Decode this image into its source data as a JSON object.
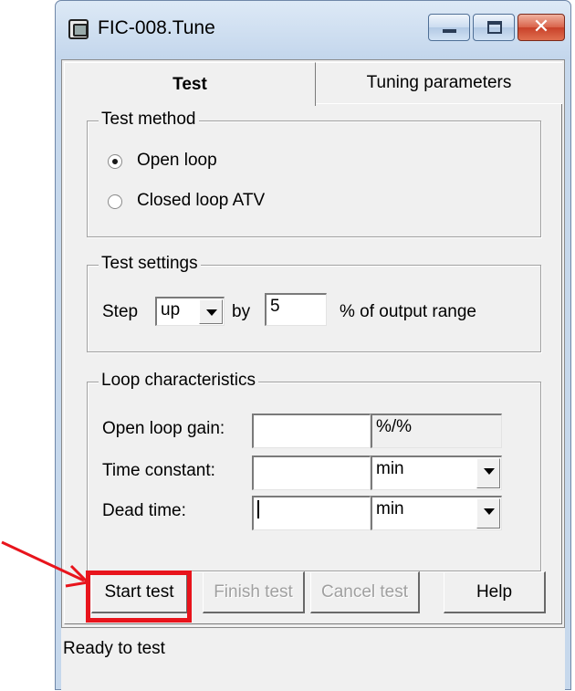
{
  "window": {
    "title": "FIC-008.Tune",
    "icon": "app-window-icon",
    "caption_buttons": [
      "minimize-icon",
      "maximize-icon",
      "close-icon"
    ],
    "close_glyph": "✕"
  },
  "tabs": [
    {
      "label": "Test",
      "selected": true
    },
    {
      "label": "Tuning parameters",
      "selected": false
    }
  ],
  "test_method": {
    "label": "Test method",
    "options": [
      {
        "label": "Open loop",
        "selected": true
      },
      {
        "label": "Closed loop ATV",
        "selected": false
      }
    ]
  },
  "test_settings": {
    "label": "Test settings",
    "step_label": "Step",
    "direction_value": "up",
    "by_label": "by",
    "amount_value": "5",
    "unit_label": "% of output range"
  },
  "loop_characteristics": {
    "label": "Loop characteristics",
    "gain_label": "Open loop gain:",
    "gain_value": "",
    "gain_unit": "%/%",
    "time_constant_label": "Time constant:",
    "time_constant_value": "",
    "time_constant_unit": "min",
    "dead_time_label": "Dead time:",
    "dead_time_value": "",
    "dead_time_unit": "min"
  },
  "buttons": {
    "start": "Start test",
    "finish": "Finish test",
    "cancel": "Cancel test",
    "help": "Help"
  },
  "status": "Ready to test",
  "annotation": {
    "arrow_color": "#e8141c",
    "highlight_color": "#e8141c"
  }
}
